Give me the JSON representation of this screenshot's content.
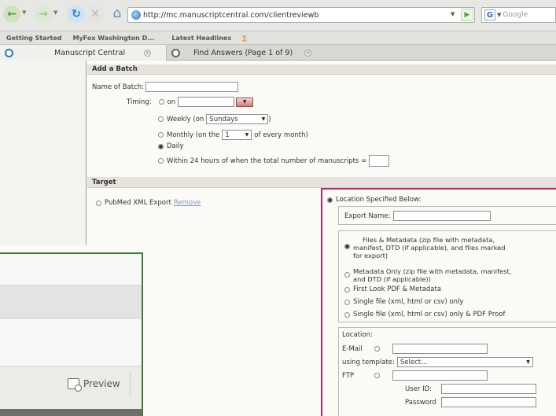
{
  "browser": {
    "url": "http://mc.manuscriptcentral.com/clientreviewb",
    "search_placeholder": "Google",
    "bookmarks": [
      "Getting Started",
      "MyFox Washington D...",
      "Latest Headlines"
    ],
    "tabs": [
      {
        "label": "Manuscript Central"
      },
      {
        "label": "Find Answers (Page 1 of 9)"
      }
    ]
  },
  "add_batch": {
    "header": "Add a Batch",
    "name_label": "Name of Batch:",
    "timing_label": "Timing:",
    "on_label": "on",
    "weekly_prefix": "Weekly (on",
    "weekly_value": "Sundays",
    "weekly_suffix": ")",
    "monthly_prefix": "Monthly (on the",
    "monthly_value": "1",
    "monthly_suffix": "of every month)",
    "daily_label": "Daily",
    "within_label": "Within 24 hours of when the total number of manuscripts ="
  },
  "target": {
    "header": "Target",
    "pubmed_label": "PubMed XML Export",
    "remove_link": "Remove",
    "location_label": "Location Specified Below:",
    "export_name_label": "Export Name:",
    "options": [
      [
        "Files & Metadata (zip file with metadata,",
        "manifest, DTD (if applicable), and files marked",
        "for export)"
      ],
      [
        "Metadata Only (zip file with metadata, manifest,",
        "and DTD (if applicable))"
      ],
      [
        "First Look PDF & Metadata"
      ],
      [
        "Single file (xml, html or csv) only"
      ],
      [
        "Single file (xml, html or csv) only & PDF Proof"
      ]
    ],
    "location_heading": "Location:",
    "email_label": "E-Mail",
    "using_template_label": "using template:",
    "template_value": "Select...",
    "ftp_label": "FTP",
    "user_id_label": "User ID:",
    "password_label": "Password"
  },
  "overlay": {
    "preview_label": "Preview"
  }
}
